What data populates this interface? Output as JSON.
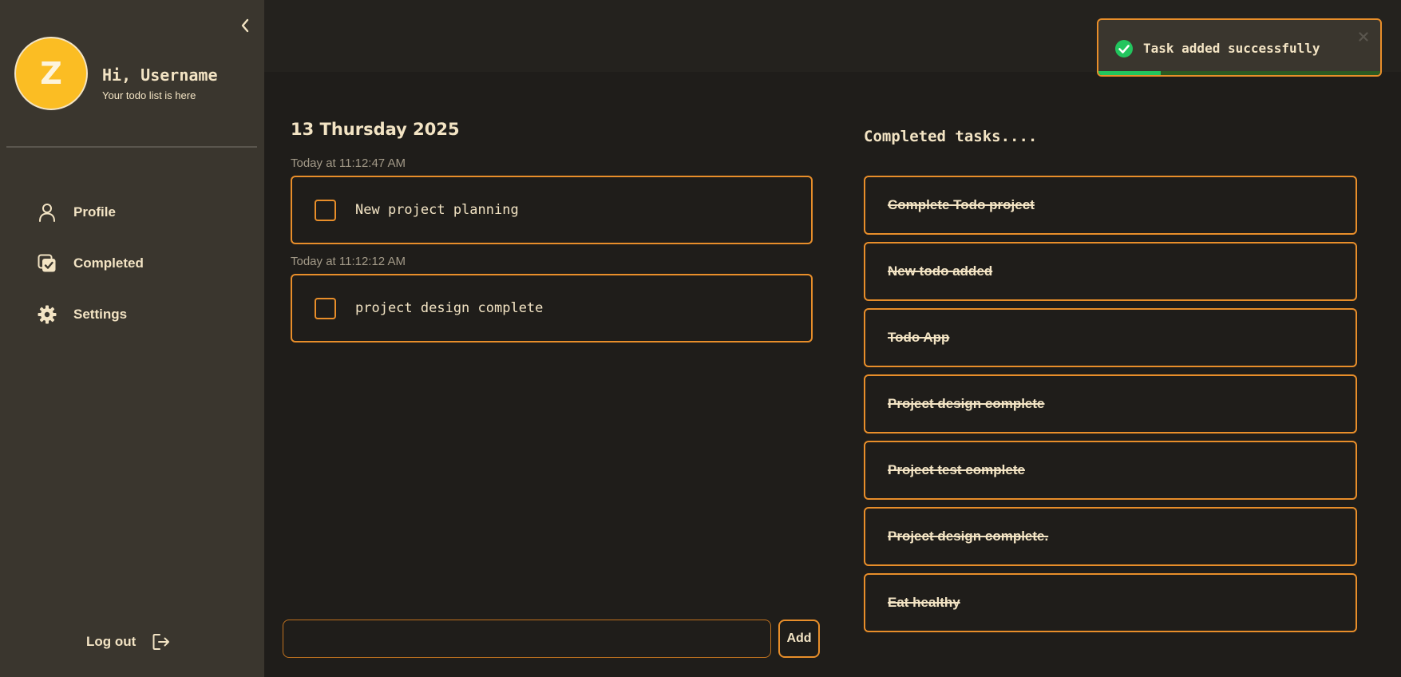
{
  "sidebar": {
    "avatar_letter": "Z",
    "greeting": "Hi, Username",
    "subtitle": "Your todo list is here",
    "nav": [
      {
        "label": "Profile",
        "icon": "user-icon"
      },
      {
        "label": "Completed",
        "icon": "check-square-icon"
      },
      {
        "label": "Settings",
        "icon": "gear-icon"
      }
    ],
    "logout_label": "Log out"
  },
  "main": {
    "date_heading": "13 Thursday 2025",
    "tasks": [
      {
        "timestamp": "Today at 11:12:47 AM",
        "text": "New project planning",
        "checked": false
      },
      {
        "timestamp": "Today at 11:12:12 AM",
        "text": "project design complete",
        "checked": false
      }
    ],
    "input": {
      "value": "",
      "placeholder": ""
    },
    "add_label": "Add"
  },
  "completed": {
    "heading": "Completed tasks....",
    "items": [
      "Complete Todo project",
      "New todo added",
      "Todo App",
      "Project design complete",
      "Project test complete",
      "Project design complete.",
      "Eat healthy"
    ]
  },
  "toast": {
    "message": "Task added successfully",
    "icon": "check-circle-icon",
    "progress_fraction": 0.22
  },
  "colors": {
    "sidebar_bg": "#3a362e",
    "page_bg": "#1f1d1a",
    "accent_border": "#e88e2a",
    "avatar": "#fbbd23",
    "success": "#22c55e",
    "text": "#f3e4c4"
  }
}
